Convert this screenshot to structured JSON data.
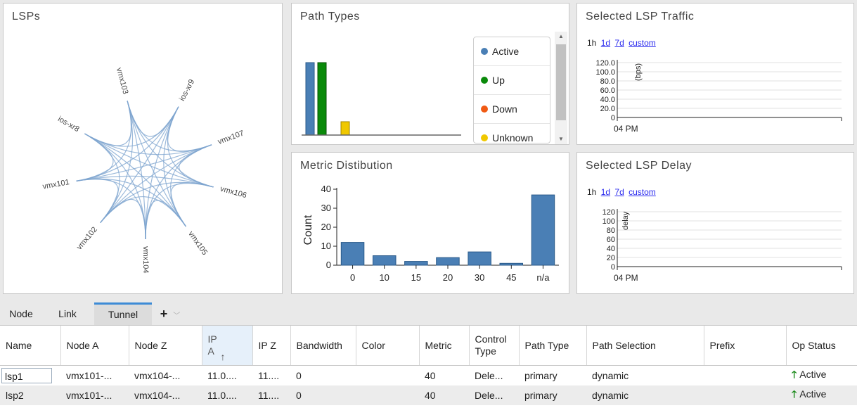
{
  "panels": {
    "lsps": {
      "title": "LSPs"
    },
    "path_types": {
      "title": "Path Types"
    },
    "lsp_traffic": {
      "title": "Selected LSP Traffic"
    },
    "metric_dist": {
      "title": "Metric Distibution"
    },
    "lsp_delay": {
      "title": "Selected LSP Delay"
    }
  },
  "lsp_nodes": [
    "vmx103",
    "ios-xr9",
    "vmx107",
    "vmx106",
    "vmx105",
    "vmx104",
    "vmx102",
    "vmx101",
    "ios-xr8"
  ],
  "path_types": {
    "legend": [
      {
        "label": "Active",
        "color": "#4a7fb5"
      },
      {
        "label": "Up",
        "color": "#0a8a0a"
      },
      {
        "label": "Down",
        "color": "#f05a14"
      },
      {
        "label": "Unknown",
        "color": "#f0c800"
      }
    ]
  },
  "time_ranges": {
    "r1h": "1h",
    "r1d": "1d",
    "r7d": "7d",
    "custom": "custom"
  },
  "traffic_chart": {
    "ylabel": "(bps)",
    "ticks": [
      "120.0",
      "100.0",
      "80.0",
      "60.0",
      "40.0",
      "20.0",
      "0"
    ],
    "xtick": "04 PM"
  },
  "delay_chart": {
    "ylabel": "delay",
    "ticks": [
      "120",
      "100",
      "80",
      "60",
      "40",
      "20",
      "0"
    ],
    "xtick": "04 PM"
  },
  "chart_data": {
    "type": "bar",
    "title": "Metric Distibution",
    "ylabel": "Count",
    "xlabel": "",
    "categories": [
      "0",
      "10",
      "15",
      "20",
      "30",
      "45",
      "n/a"
    ],
    "values": [
      12,
      5,
      2,
      4,
      7,
      1,
      37
    ],
    "ylim": [
      0,
      40
    ],
    "yticks": [
      "0",
      "10",
      "20",
      "30",
      "40"
    ],
    "color": "#4a7fb5"
  },
  "tabs": {
    "node": "Node",
    "link": "Link",
    "tunnel": "Tunnel",
    "add": "+"
  },
  "table": {
    "headers": {
      "name": "Name",
      "node_a": "Node A",
      "node_z": "Node Z",
      "ip_a": "IP A",
      "ip_a_sort": "↑",
      "ip_z": "IP Z",
      "bandwidth": "Bandwidth",
      "color": "Color",
      "metric": "Metric",
      "control_type": "Control Type",
      "path_type": "Path Type",
      "path_selection": "Path Selection",
      "prefix": "Prefix",
      "op_status": "Op Status"
    },
    "rows": [
      {
        "name": "lsp1",
        "node_a": "vmx101-...",
        "node_z": "vmx104-...",
        "ip_a": "11.0....",
        "ip_z": "11....",
        "bandwidth": "0",
        "color": "",
        "metric": "40",
        "control_type": "Dele...",
        "path_type": "primary",
        "path_selection": "dynamic",
        "prefix": "",
        "op_status": "Active"
      },
      {
        "name": "lsp2",
        "node_a": "vmx101-...",
        "node_z": "vmx104-...",
        "ip_a": "11.0....",
        "ip_z": "11....",
        "bandwidth": "0",
        "color": "",
        "metric": "40",
        "control_type": "Dele...",
        "path_type": "primary",
        "path_selection": "dynamic",
        "prefix": "",
        "op_status": "Active"
      }
    ]
  }
}
